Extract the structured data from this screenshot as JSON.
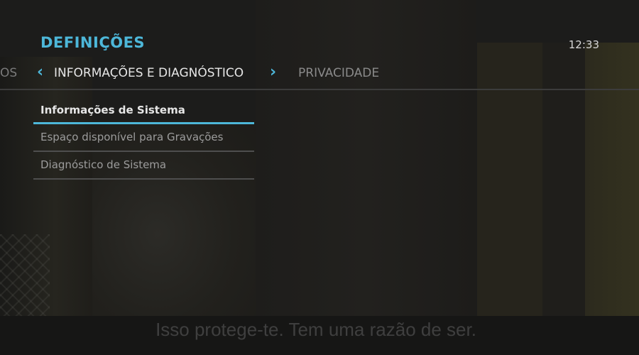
{
  "header": {
    "title": "DEFINIÇÕES",
    "clock": "12:33"
  },
  "tabs": {
    "previous": "OS",
    "active": "INFORMAÇÕES E DIAGNÓSTICO",
    "next": "PRIVACIDADE"
  },
  "menu": {
    "items": [
      {
        "label": "Informações de Sistema",
        "selected": true
      },
      {
        "label": "Espaço disponível para Gravações",
        "selected": false
      },
      {
        "label": "Diagnóstico de Sistema",
        "selected": false
      }
    ]
  },
  "subtitle": "Isso protege-te. Tem uma razão de ser.",
  "colors": {
    "accent": "#4db7d9"
  },
  "icons": {
    "prev": "chevron-left-icon",
    "next": "chevron-right-icon"
  }
}
